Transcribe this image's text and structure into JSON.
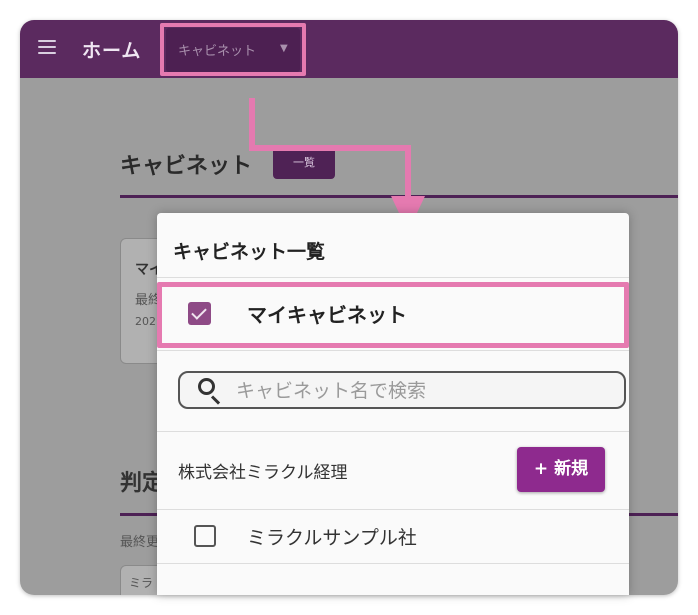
{
  "appbar": {
    "title": "ホーム",
    "cabinet_select": {
      "label": "キャビネット",
      "caret": "▼"
    }
  },
  "background": {
    "section_heading": "キャビネット",
    "list_button": "一覧",
    "card_partial_title": "マイ",
    "card_partial_meta": "最終",
    "card_partial_date": "202",
    "section2_partial_heading": "判定",
    "section2_partial_meta": "最終更",
    "section2_partial_card": "ミラ"
  },
  "dropdown": {
    "title": "キャビネット一覧",
    "my_cabinet": {
      "label": "マイキャビネット",
      "checked": true
    },
    "search": {
      "placeholder": "キャビネット名で検索",
      "value": ""
    },
    "company": {
      "name": "株式会社ミラクル経理",
      "new_button": "+ 新規"
    },
    "cabinets": [
      {
        "label": "ミラクルサンプル社",
        "checked": false
      }
    ]
  },
  "colors": {
    "appbar": "#5b2a5f",
    "accent": "#8e2a8e",
    "highlight": "#e57ab0"
  }
}
